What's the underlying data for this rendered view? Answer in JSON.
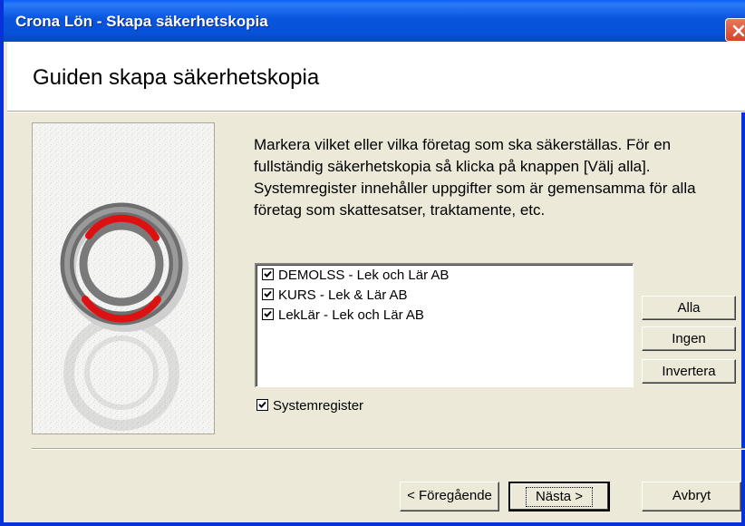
{
  "window": {
    "title": "Crona Lön - Skapa säkerhetskopia"
  },
  "header": {
    "heading": "Guiden skapa säkerhetskopia"
  },
  "instructions": "Markera vilket eller vilka företag som ska säkerställas. För en fullständig säkerhetskopia så klicka på knappen [Välj alla]. Systemregister innehåller uppgifter som är gemensamma för alla företag som skattesatser, traktamente, etc.",
  "companies": [
    {
      "label": "DEMOLSS - Lek och Lär AB",
      "checked": true
    },
    {
      "label": "KURS - Lek & Lär AB",
      "checked": true
    },
    {
      "label": "LekLär - Lek och Lär AB",
      "checked": true
    }
  ],
  "side_buttons": {
    "all": "Alla",
    "none": "Ingen",
    "invert": "Invertera"
  },
  "system_register": {
    "label": "Systemregister",
    "checked": true
  },
  "footer_buttons": {
    "back": "< Föregående",
    "next": "Nästa >",
    "cancel": "Avbryt"
  },
  "colors": {
    "titlebar": "#0855dd",
    "close_button": "#d4432c",
    "dialog_background": "#ece9d8",
    "ring_accent": "#dd1111"
  },
  "icons": {
    "close": "close-icon",
    "wizard_image": "lifebuoy-image",
    "checkmark": "checkmark-icon"
  }
}
